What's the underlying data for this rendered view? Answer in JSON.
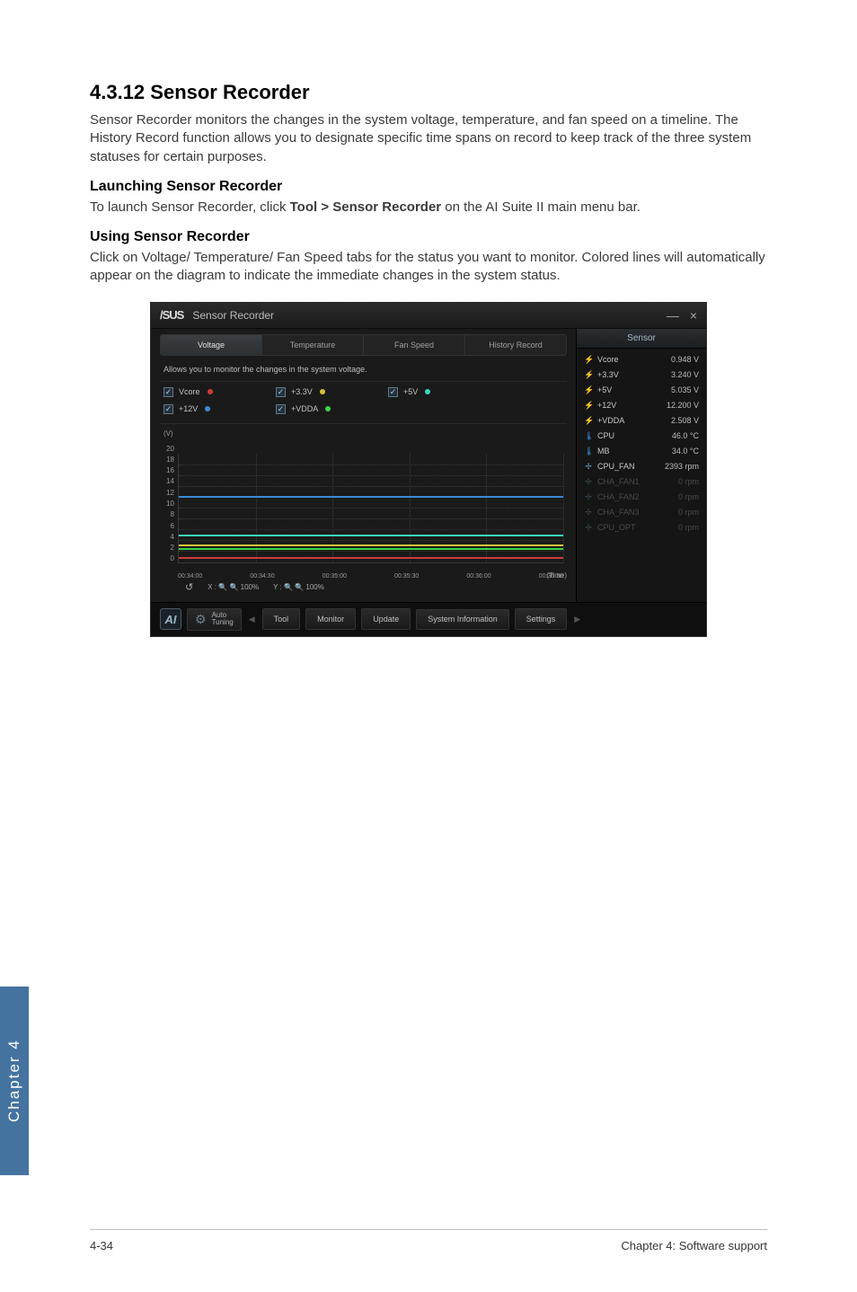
{
  "heading": "4.3.12    Sensor Recorder",
  "intro": "Sensor Recorder monitors the changes in the system voltage, temperature, and fan speed on a timeline. The History Record function allows you to designate specific time spans on record to keep track of the three system statuses for certain purposes.",
  "sub1_title": "Launching Sensor Recorder",
  "sub1_text_a": "To launch Sensor Recorder, click ",
  "sub1_text_bold": "Tool > Sensor Recorder",
  "sub1_text_b": " on the AI Suite II main menu bar.",
  "sub2_title": "Using Sensor Recorder",
  "sub2_text": "Click on Voltage/ Temperature/ Fan Speed tabs for the status you want to monitor. Colored lines will automatically appear on the diagram to indicate the immediate changes in the system status.",
  "screenshot": {
    "logo": "/SUS",
    "window_title": "Sensor Recorder",
    "win_min": "—",
    "win_close": "×",
    "tabs": [
      "Voltage",
      "Temperature",
      "Fan Speed",
      "History Record"
    ],
    "active_tab": 0,
    "desc": "Allows you to monitor the changes in the system voltage.",
    "checks": [
      {
        "label": "Vcore",
        "dot": "dot-red"
      },
      {
        "label": "+3.3V",
        "dot": "dot-yellow"
      },
      {
        "label": "+5V",
        "dot": "dot-teal"
      },
      {
        "label": "+12V",
        "dot": "dot-blue"
      },
      {
        "label": "+VDDA",
        "dot": "dot-green"
      }
    ],
    "y_label": "(V)",
    "time_label": "(Time)",
    "zoom": {
      "reset": "↺",
      "x_label": "X :",
      "x_val": "100%",
      "y_label": "Y :",
      "y_val": "100%"
    },
    "sensor_header": "Sensor",
    "sensors": [
      {
        "icon": "bolt",
        "name": "Vcore",
        "value": "0.948 V"
      },
      {
        "icon": "bolt",
        "name": "+3.3V",
        "value": "3.240 V"
      },
      {
        "icon": "bolt",
        "name": "+5V",
        "value": "5.035 V"
      },
      {
        "icon": "bolt",
        "name": "+12V",
        "value": "12.200 V"
      },
      {
        "icon": "bolt",
        "name": "+VDDA",
        "value": "2.508 V"
      },
      {
        "icon": "therm",
        "name": "CPU",
        "value": "46.0 °C"
      },
      {
        "icon": "therm",
        "name": "MB",
        "value": "34.0 °C"
      },
      {
        "icon": "fan",
        "name": "CPU_FAN",
        "value": "2393 rpm"
      },
      {
        "icon": "fan",
        "name": "CHA_FAN1",
        "value": "0 rpm",
        "dim": true
      },
      {
        "icon": "fan",
        "name": "CHA_FAN2",
        "value": "0 rpm",
        "dim": true
      },
      {
        "icon": "fan",
        "name": "CHA_FAN3",
        "value": "0 rpm",
        "dim": true
      },
      {
        "icon": "fan",
        "name": "CPU_OPT",
        "value": "0 rpm",
        "dim": true
      }
    ],
    "footer": {
      "ai": "AI",
      "auto": {
        "l1": "Auto",
        "l2": "Tuning"
      },
      "buttons": [
        "Tool",
        "Monitor",
        "Update",
        "System Information",
        "Settings"
      ]
    }
  },
  "chart_data": {
    "type": "line",
    "title": "",
    "xlabel": "(Time)",
    "ylabel": "(V)",
    "ylim": [
      0,
      20
    ],
    "y_ticks": [
      20,
      18,
      16,
      14,
      12,
      10,
      8,
      6,
      4,
      2,
      0
    ],
    "x_ticks": [
      "00:34:00",
      "00:34:30",
      "00:35:00",
      "00:35:30",
      "00:36:00",
      "00:36:30"
    ],
    "series": [
      {
        "name": "Vcore",
        "color": "#d43b3b",
        "value": 0.948
      },
      {
        "name": "+3.3V",
        "color": "#d6c23b",
        "value": 3.24
      },
      {
        "name": "+5V",
        "color": "#3bd6b8",
        "value": 5.035
      },
      {
        "name": "+12V",
        "color": "#3b8bd6",
        "value": 12.2
      },
      {
        "name": "+VDDA",
        "color": "#3bd64b",
        "value": 2.508
      }
    ]
  },
  "side_tab": "Chapter 4",
  "footer_left": "4-34",
  "footer_right": "Chapter 4: Software support"
}
